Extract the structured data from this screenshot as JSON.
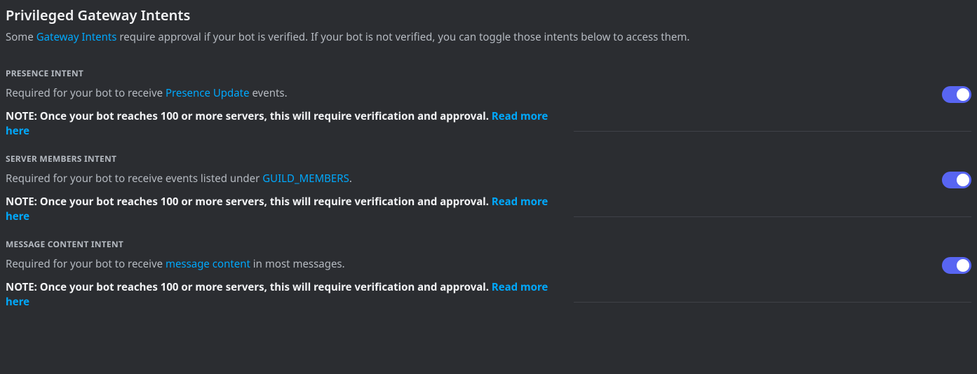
{
  "header": {
    "title": "Privileged Gateway Intents",
    "subtitle_prefix": "Some ",
    "subtitle_link": "Gateway Intents",
    "subtitle_suffix": " require approval if your bot is verified. If your bot is not verified, you can toggle those intents below to access them."
  },
  "intents": [
    {
      "label": "PRESENCE INTENT",
      "desc_prefix": "Required for your bot to receive ",
      "desc_link": "Presence Update",
      "desc_suffix": " events.",
      "note_text": "NOTE: Once your bot reaches 100 or more servers, this will require verification and approval. ",
      "note_link": "Read more here",
      "enabled": true
    },
    {
      "label": "SERVER MEMBERS INTENT",
      "desc_prefix": "Required for your bot to receive events listed under ",
      "desc_link": "GUILD_MEMBERS",
      "desc_suffix": ".",
      "note_text": "NOTE: Once your bot reaches 100 or more servers, this will require verification and approval. ",
      "note_link": "Read more here",
      "enabled": true
    },
    {
      "label": "MESSAGE CONTENT INTENT",
      "desc_prefix": "Required for your bot to receive ",
      "desc_link": "message content",
      "desc_suffix": " in most messages.",
      "note_text": "NOTE: Once your bot reaches 100 or more servers, this will require verification and approval. ",
      "note_link": "Read more here",
      "enabled": true
    }
  ]
}
